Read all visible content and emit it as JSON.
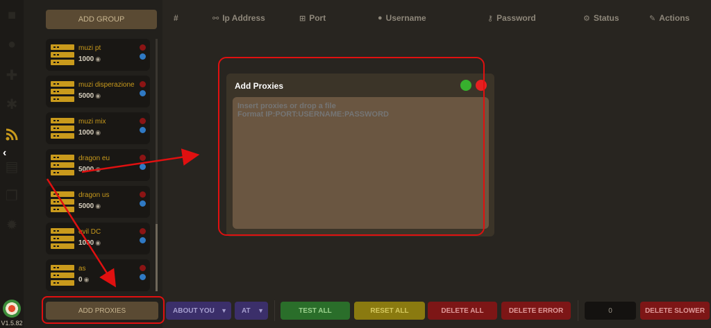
{
  "sidebar_rail": {
    "icons": [
      "account-icon",
      "user-circle-icon",
      "puzzle-icon",
      "plugin-icon",
      "rss-icon",
      "chart-icon",
      "copy-icon",
      "gear-icon"
    ],
    "active": "rss-icon",
    "collapse_glyph": "‹",
    "version": "V1.5.82"
  },
  "groups": {
    "add_group_label": "ADD GROUP",
    "items": [
      {
        "name": "muzi pt",
        "count": "1000"
      },
      {
        "name": "muzi disperazione",
        "count": "5000"
      },
      {
        "name": "muzi mix",
        "count": "1000"
      },
      {
        "name": "dragon eu",
        "count": "5000"
      },
      {
        "name": "dragon us",
        "count": "5000"
      },
      {
        "name": "evil DC",
        "count": "1000"
      },
      {
        "name": "as",
        "count": "0"
      }
    ]
  },
  "table_header": {
    "columns": [
      {
        "label": "#",
        "icon": ""
      },
      {
        "label": "Ip Address",
        "icon": "network-icon"
      },
      {
        "label": "Port",
        "icon": "sitemap-icon"
      },
      {
        "label": "Username",
        "icon": "user-icon"
      },
      {
        "label": "Password",
        "icon": "key-icon"
      },
      {
        "label": "Status",
        "icon": "gears-icon"
      },
      {
        "label": "Actions",
        "icon": "wrench-icon"
      }
    ]
  },
  "modal": {
    "title": "Add Proxies",
    "textarea_placeholder": "Insert proxies or drop a file\nFormat IP:PORT:USERNAME:PASSWORD"
  },
  "toolbar": {
    "add_proxies_label": "ADD PROXIES",
    "group_select": "ABOUT YOU",
    "mode_select": "AT",
    "test_all": "TEST ALL",
    "reset_all": "RESET ALL",
    "delete_all": "DELETE ALL",
    "delete_error": "DELETE ERROR",
    "slow_threshold": "0",
    "delete_slower": "DELETE SLOWER"
  },
  "colors": {
    "accent_gold": "#c99a1c",
    "annotation_red": "#e01010",
    "status_red": "#8b1414",
    "status_blue": "#2f79c4",
    "confirm_green": "#37b02e",
    "close_red": "#e52020"
  }
}
